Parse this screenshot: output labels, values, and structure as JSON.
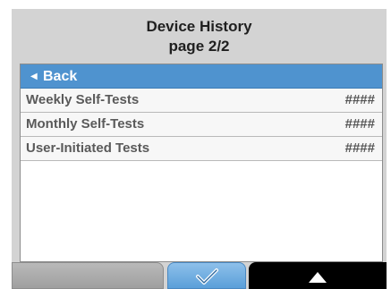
{
  "header": {
    "title": "Device History",
    "subtitle": "page 2/2"
  },
  "menu": {
    "back_label": "Back",
    "items": [
      {
        "label": "Weekly Self-Tests",
        "value": "####"
      },
      {
        "label": "Monthly Self-Tests",
        "value": "####"
      },
      {
        "label": "User-Initiated Tests",
        "value": "####"
      }
    ]
  },
  "softkeys": {
    "left": {
      "icon": "blank"
    },
    "center": {
      "icon": "checkmark-icon"
    },
    "right": {
      "icon": "up-arrow-icon"
    }
  },
  "colors": {
    "background": "#d3d3d3",
    "highlight": "#4f93cf",
    "text": "#5a5a5a"
  }
}
